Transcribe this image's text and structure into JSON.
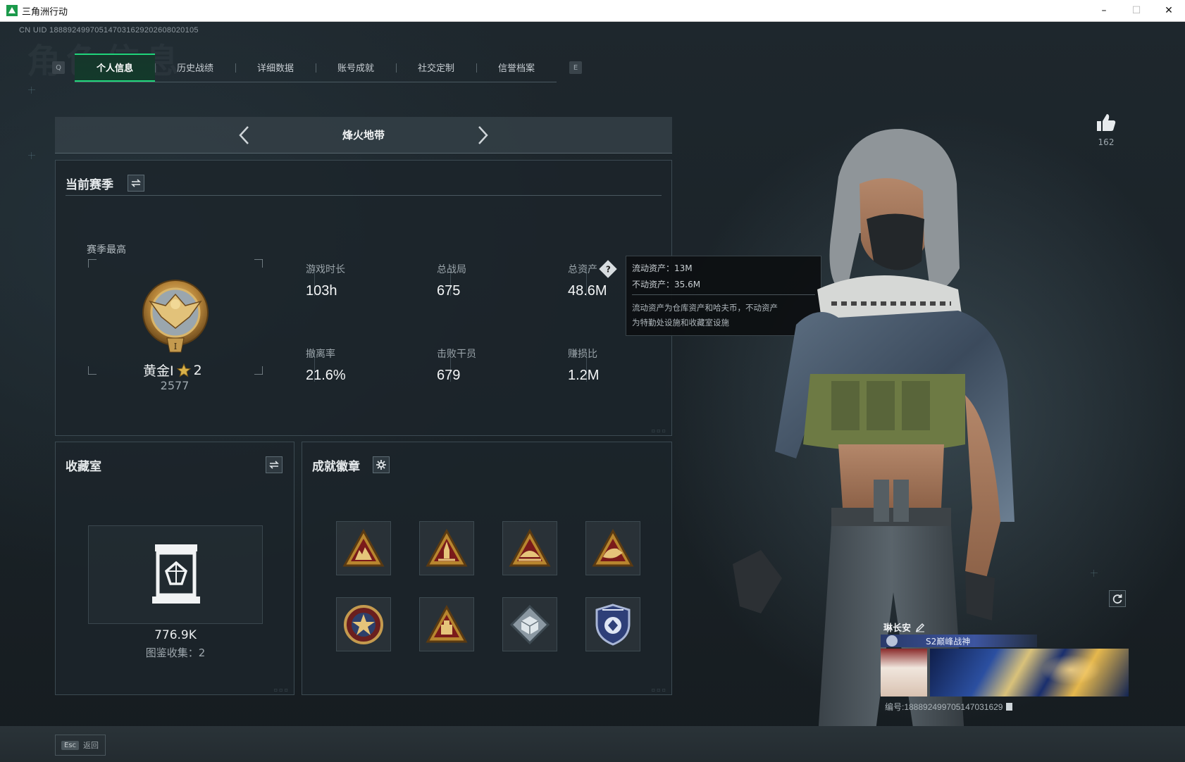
{
  "window": {
    "title": "三角洲行动",
    "controls": [
      "minimize",
      "maximize",
      "close"
    ]
  },
  "header": {
    "uid_line": "CN UID 1888924997051470316292026080201​05",
    "watermark": "角色信息"
  },
  "tabs": {
    "left_key": "Q",
    "right_key": "E",
    "items": [
      {
        "label": "个人信息",
        "active": true
      },
      {
        "label": "历史战绩",
        "active": false
      },
      {
        "label": "详细数据",
        "active": false
      },
      {
        "label": "账号成就",
        "active": false
      },
      {
        "label": "社交定制",
        "active": false
      },
      {
        "label": "信誉档案",
        "active": false
      }
    ]
  },
  "mode_selector": {
    "current": "烽火地带"
  },
  "season": {
    "title": "当前赛季",
    "best_label": "赛季最高",
    "rank_name": "黄金I",
    "rank_stars": "2",
    "rank_score": "2577",
    "stats": {
      "playtime": {
        "label": "游戏时长",
        "value": "103h"
      },
      "matches": {
        "label": "总战局",
        "value": "675"
      },
      "assets": {
        "label": "总资产",
        "value": "48.6M"
      },
      "extract_rate": {
        "label": "撤离率",
        "value": "21.6%"
      },
      "kills": {
        "label": "击败干员",
        "value": "679"
      },
      "profit_ratio": {
        "label": "赚损比",
        "value": "1.2M"
      }
    }
  },
  "assets_tooltip": {
    "liquid": "流动资产：13M",
    "fixed": "不动资产：35.6M",
    "note_line1": "流动资产为仓库资产和哈夫币，不动资产",
    "note_line2": "为特勤处设施和收藏室设施"
  },
  "collection": {
    "title": "收藏室",
    "value": "776.9K",
    "count_text": "图鉴收集：2"
  },
  "badges": {
    "title": "成就徽章",
    "items": [
      {
        "icon": "triangle-soldiers-badge-icon"
      },
      {
        "icon": "triangle-rocket-badge-icon"
      },
      {
        "icon": "triangle-dome-badge-icon"
      },
      {
        "icon": "triangle-boar-badge-icon"
      },
      {
        "icon": "star-medal-badge-icon"
      },
      {
        "icon": "triangle-cargo-badge-icon"
      },
      {
        "icon": "diamond-cube-badge-icon"
      },
      {
        "icon": "shield-crest-badge-icon"
      }
    ]
  },
  "likes": {
    "count": "162"
  },
  "profile_card": {
    "player_name": "琳长安",
    "title_badge": "S2巅峰战神",
    "uid_text": "编号:1888924997051470316​29"
  },
  "footer": {
    "esc_key": "Esc",
    "esc_label": "返回"
  },
  "colors": {
    "accent_green": "#1fd47a",
    "panel_bg": "#1c252b",
    "title_strip": "#3d55a0"
  }
}
